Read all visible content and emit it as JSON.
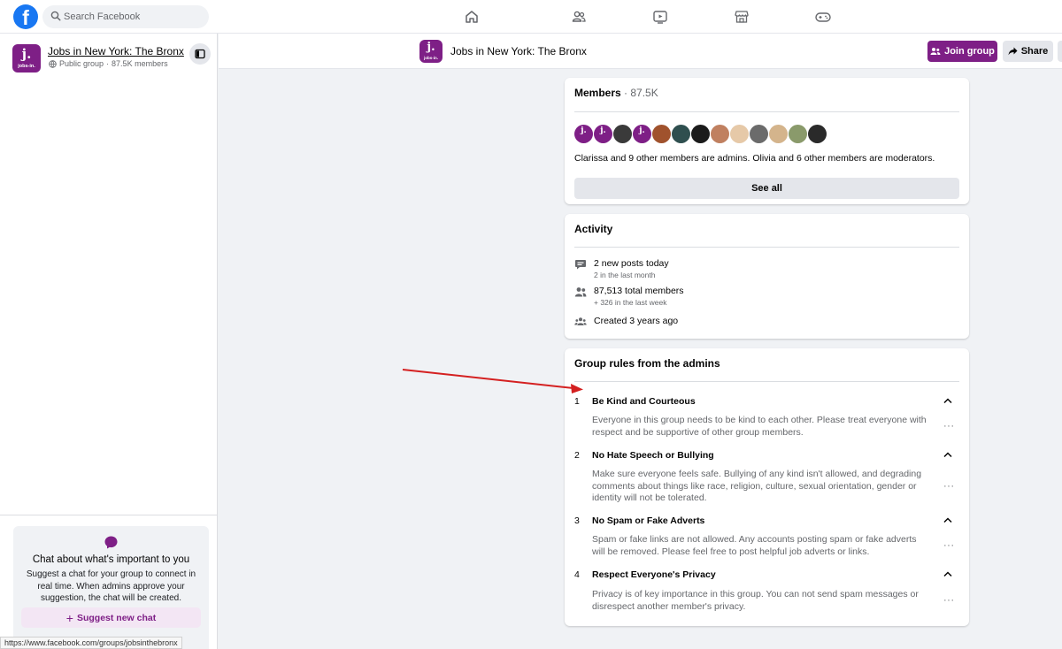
{
  "topbar": {
    "logo": "f",
    "search_placeholder": "Search Facebook",
    "nav_icons": [
      "home-icon",
      "groups-icon",
      "video-icon",
      "marketplace-icon",
      "gaming-icon"
    ]
  },
  "brand_avatar": {
    "letter": "j.",
    "text": "jobs-in."
  },
  "sidebar": {
    "group_name": "Jobs in New York: The Bronx",
    "privacy": "Public group",
    "separator": "·",
    "members": "87.5K members",
    "chat": {
      "title": "Chat about what's important to you",
      "description": "Suggest a chat for your group to connect in real time. When admins approve your suggestion, the chat will be created.",
      "button": "Suggest new chat"
    },
    "status_url": "https://www.facebook.com/groups/jobsinthebronx"
  },
  "group_header": {
    "title": "Jobs in New York: The Bronx",
    "join_label": "Join group",
    "share_label": "Share"
  },
  "members_card": {
    "title": "Members",
    "count": "· 87.5K",
    "admins_text": "Clarissa and 9 other members are admins. Olivia and 6 other members are moderators.",
    "see_all": "See all",
    "avatar_colors": [
      "#7e1f86",
      "#7e1f86",
      "#3a3a3a",
      "#7e1f86",
      "#a0522d",
      "#2f4f4f",
      "#1b1b1b",
      "#c08060",
      "#e6c9a8",
      "#6b6b6b",
      "#d4b48c",
      "#8a9a6b",
      "#2a2a2a"
    ]
  },
  "activity_card": {
    "title": "Activity",
    "items": [
      {
        "main": "2 new posts today",
        "sub": "2 in the last month"
      },
      {
        "main": "87,513 total members",
        "sub": "+ 326 in the last week"
      },
      {
        "main": "Created 3 years ago",
        "sub": ""
      }
    ]
  },
  "rules_card": {
    "title": "Group rules from the admins",
    "more": "···",
    "rules": [
      {
        "num": "1",
        "title": "Be Kind and Courteous",
        "desc": "Everyone in this group needs to be kind to each other. Please treat everyone with respect and be supportive of other group members."
      },
      {
        "num": "2",
        "title": "No Hate Speech or Bullying",
        "desc": "Make sure everyone feels safe. Bullying of any kind isn't allowed, and degrading comments about things like race, religion, culture, sexual orientation, gender or identity will not be tolerated."
      },
      {
        "num": "3",
        "title": "No Spam or Fake Adverts",
        "desc": "Spam or fake links are not allowed. Any accounts posting spam or fake adverts will be removed. Please feel free to post helpful job adverts or links."
      },
      {
        "num": "4",
        "title": "Respect Everyone's Privacy",
        "desc": "Privacy is of key importance in this group. You can not send spam messages or disrespect another member's privacy."
      }
    ]
  },
  "colors": {
    "brand_purple": "#7e1f86",
    "facebook_blue": "#1877f2",
    "annotation_arrow": "#d42020"
  }
}
